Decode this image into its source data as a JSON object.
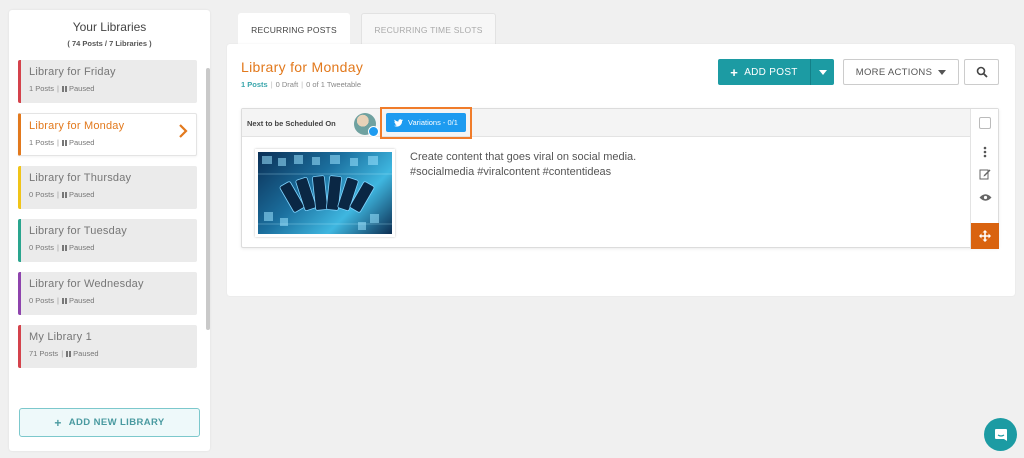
{
  "sidebar": {
    "title": "Your Libraries",
    "subtitle": "( 74 Posts / 7 Libraries )",
    "libraries": [
      {
        "name": "Library for Friday",
        "posts": "1 Posts",
        "status": "Paused",
        "color": "#d4434c"
      },
      {
        "name": "Library for Monday",
        "posts": "1 Posts",
        "status": "Paused",
        "color": "#e2791d"
      },
      {
        "name": "Library for Thursday",
        "posts": "0 Posts",
        "status": "Paused",
        "color": "#f0c419"
      },
      {
        "name": "Library for Tuesday",
        "posts": "0 Posts",
        "status": "Paused",
        "color": "#2aa58e"
      },
      {
        "name": "Library for Wednesday",
        "posts": "0 Posts",
        "status": "Paused",
        "color": "#8e44ad"
      },
      {
        "name": "My Library 1",
        "posts": "71 Posts",
        "status": "Paused",
        "color": "#d4434c"
      }
    ],
    "add_button": "ADD NEW LIBRARY"
  },
  "tabs": {
    "recurring_posts": "RECURRING POSTS",
    "recurring_slots": "RECURRING TIME SLOTS"
  },
  "main": {
    "title": "Library for Monday",
    "stats": {
      "posts": "1 Posts",
      "draft": "0 Draft",
      "tweetable": "0 of 1 Tweetable"
    },
    "add_post": "ADD POST",
    "more_actions": "MORE ACTIONS"
  },
  "post": {
    "next_label": "Next to be Scheduled On",
    "variations": "Variations - 0/1",
    "line1": "Create content that goes viral on social media.",
    "line2": "#socialmedia #viralcontent #contentideas"
  },
  "colors": {
    "accent": "#e2791d",
    "teal": "#1c9ba3",
    "twitter": "#1d9bf0"
  }
}
